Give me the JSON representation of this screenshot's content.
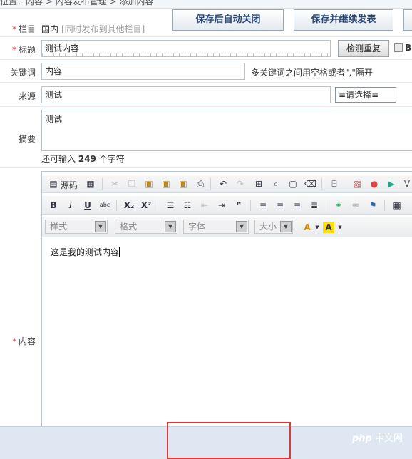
{
  "breadcrumb": "位置：内容 > 内容发布管理 > 添加内容",
  "form": {
    "column": {
      "label": "栏目",
      "value": "国内",
      "sync": "[同时发布到其他栏目]"
    },
    "title": {
      "label": "标题",
      "value": "测试内容",
      "check_button": "检测重复"
    },
    "keywords": {
      "label": "关键词",
      "value": "内容",
      "hint": "多关键词之间用空格或者\",\"隔开"
    },
    "source": {
      "label": "来源",
      "value": "测试",
      "select": "≡请选择≡"
    },
    "summary": {
      "label": "摘要",
      "value": "测试",
      "remain_prefix": "还可输入",
      "remain_count": "249",
      "remain_suffix": "个字符"
    },
    "content": {
      "label": "内容",
      "text": "这是我的测试内容"
    }
  },
  "editor": {
    "source_label": "源码",
    "combos": {
      "style": "样式",
      "format": "格式",
      "font": "字体",
      "size": "大小"
    }
  },
  "footer": {
    "save_close": "保存后自动关闭",
    "save_continue": "保存并继续发表",
    "watermark": {
      "brand": "php",
      "site": "中文网"
    }
  }
}
